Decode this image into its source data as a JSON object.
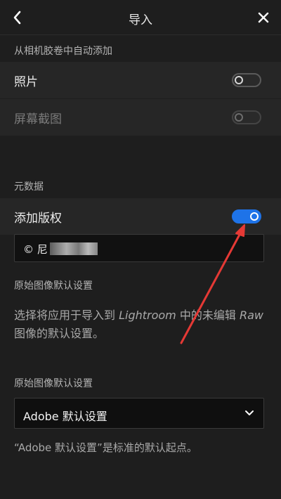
{
  "header": {
    "title": "导入",
    "back_icon": "chevron-left-icon",
    "close_icon": "close-icon"
  },
  "auto_add": {
    "section_label": "从相机胶卷中自动添加",
    "photos_label": "照片",
    "photos_on": false,
    "screenshots_label": "屏幕截图",
    "screenshots_on": false
  },
  "metadata": {
    "section_label": "元数据",
    "add_copyright_label": "添加版权",
    "add_copyright_on": true,
    "copyright_value": "© 尼"
  },
  "raw_defaults": {
    "section_label": "原始图像默认设置",
    "description_part1": "选择将应用于导入到 ",
    "description_app": "Lightroom",
    "description_part2": " 中的未编辑 ",
    "description_raw": "Raw",
    "description_part3": " 图像的默认设置。",
    "select_label": "原始图像默认设置",
    "select_value": "Adobe 默认设置",
    "note": "“Adobe 默认设置”是标准的默认起点。"
  },
  "colors": {
    "accent": "#1e73e8",
    "annotation": "#e53935"
  }
}
